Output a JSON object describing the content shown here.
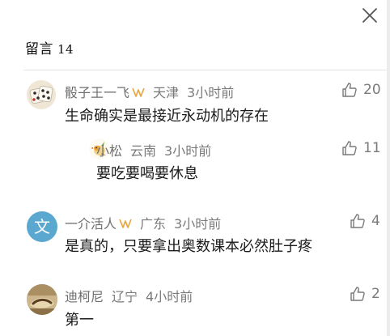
{
  "header": {
    "title": "留言",
    "count": "14"
  },
  "comments": [
    {
      "name": "骰子王一飞",
      "verified": true,
      "location": "天津",
      "time": "3小时前",
      "text": "生命确实是最接近永动机的存在",
      "likes": "20",
      "avatar": "dice-avatar",
      "replies": [
        {
          "name": "小松",
          "verified": false,
          "location": "云南",
          "time": "3小时前",
          "text": "要吃要喝要休息",
          "likes": "11",
          "avatar": "bird-avatar"
        }
      ]
    },
    {
      "name": "一介活人",
      "verified": true,
      "location": "广东",
      "time": "3小时前",
      "text": "是真的，只要拿出奥数课本必然肚子疼",
      "likes": "4",
      "avatar": "letter-avatar",
      "avatar_letter": "文",
      "avatar_color": "#5aa7cf"
    },
    {
      "name": "迪柯尼",
      "verified": false,
      "location": "辽宁",
      "time": "4小时前",
      "text": "第一",
      "likes": "2",
      "avatar": "photo-avatar"
    }
  ],
  "colors": {
    "meta": "#7a7a7a",
    "body": "#1a1a1a",
    "verified_badge": "#e8a23a"
  },
  "icons": {
    "close": "close-icon",
    "like": "thumbs-up-icon",
    "verified": "verified-badge-icon"
  }
}
